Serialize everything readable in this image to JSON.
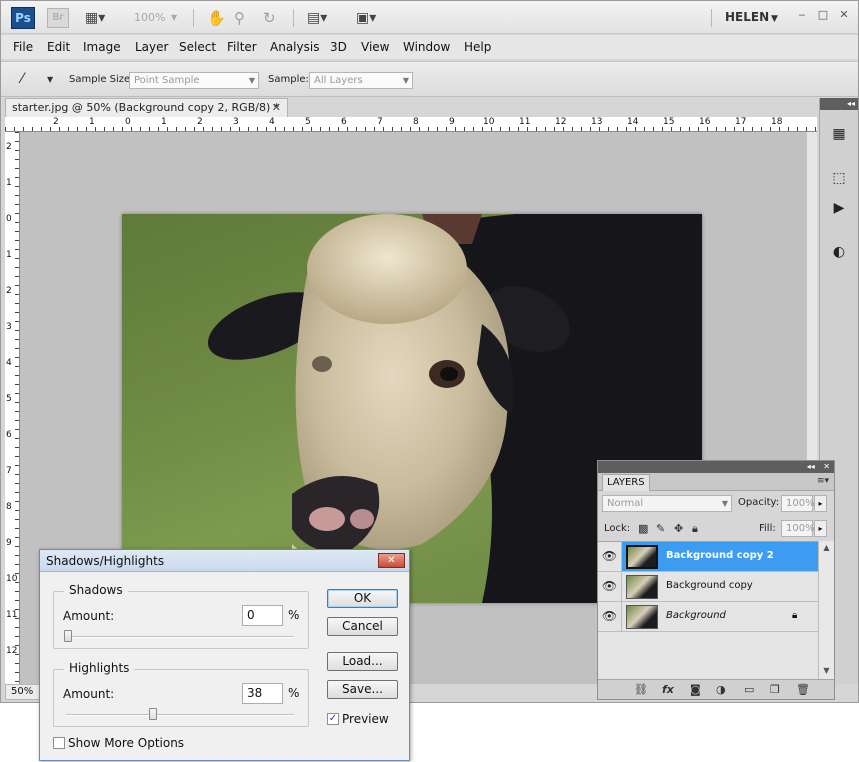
{
  "appbar": {
    "ps_logo": "Ps",
    "br_logo": "Br",
    "zoom": "100%",
    "user": "HELEN",
    "window_controls": [
      "‒",
      "□",
      "✕"
    ]
  },
  "menu": [
    "File",
    "Edit",
    "Image",
    "Layer",
    "Select",
    "Filter",
    "Analysis",
    "3D",
    "View",
    "Window",
    "Help"
  ],
  "options_bar": {
    "tool_icon": "eyedropper-icon",
    "sample_size_label": "Sample Size:",
    "sample_size_value": "Point Sample",
    "sample_label": "Sample:",
    "sample_value": "All Layers"
  },
  "document": {
    "tab_title": "starter.jpg @ 50% (Background copy 2, RGB/8) *",
    "zoom_status": "50%"
  },
  "rulers": {
    "h_labels": [
      "2",
      "1",
      "0",
      "1",
      "2",
      "3",
      "4",
      "5",
      "6",
      "7",
      "8",
      "9",
      "10",
      "11",
      "12",
      "13",
      "14",
      "15",
      "16",
      "17",
      "18"
    ],
    "v_labels": [
      "2",
      "1",
      "0",
      "1",
      "2",
      "3",
      "4",
      "5",
      "6",
      "7",
      "8",
      "9",
      "10",
      "11",
      "12"
    ]
  },
  "layers_panel": {
    "tab": "LAYERS",
    "blend_mode": "Normal",
    "opacity_label": "Opacity:",
    "opacity_value": "100%",
    "lock_label": "Lock:",
    "fill_label": "Fill:",
    "fill_value": "100%",
    "layers": [
      {
        "name": "Background copy 2",
        "selected": true
      },
      {
        "name": "Background copy",
        "selected": false
      },
      {
        "name": "Background",
        "selected": false
      }
    ],
    "footer_icons": [
      "link-icon",
      "fx-icon",
      "mask-icon",
      "adjustment-icon",
      "group-icon",
      "new-layer-icon",
      "trash-icon"
    ]
  },
  "dialog": {
    "title": "Shadows/Highlights",
    "shadows": {
      "title": "Shadows",
      "amount_label": "Amount:",
      "amount_value": "0",
      "unit": "%",
      "slider_fraction": 0.0
    },
    "highlights": {
      "title": "Highlights",
      "amount_label": "Amount:",
      "amount_value": "38",
      "unit": "%",
      "slider_fraction": 0.38
    },
    "buttons": {
      "ok": "OK",
      "cancel": "Cancel",
      "load": "Load...",
      "save": "Save..."
    },
    "preview_label": "Preview",
    "preview_checked": true,
    "show_more_label": "Show More Options",
    "show_more_checked": false
  },
  "colors": {
    "selection": "#3d9bf2",
    "canvas_bg": "#c1c1c1",
    "panel_title": "#5e5e5e"
  }
}
